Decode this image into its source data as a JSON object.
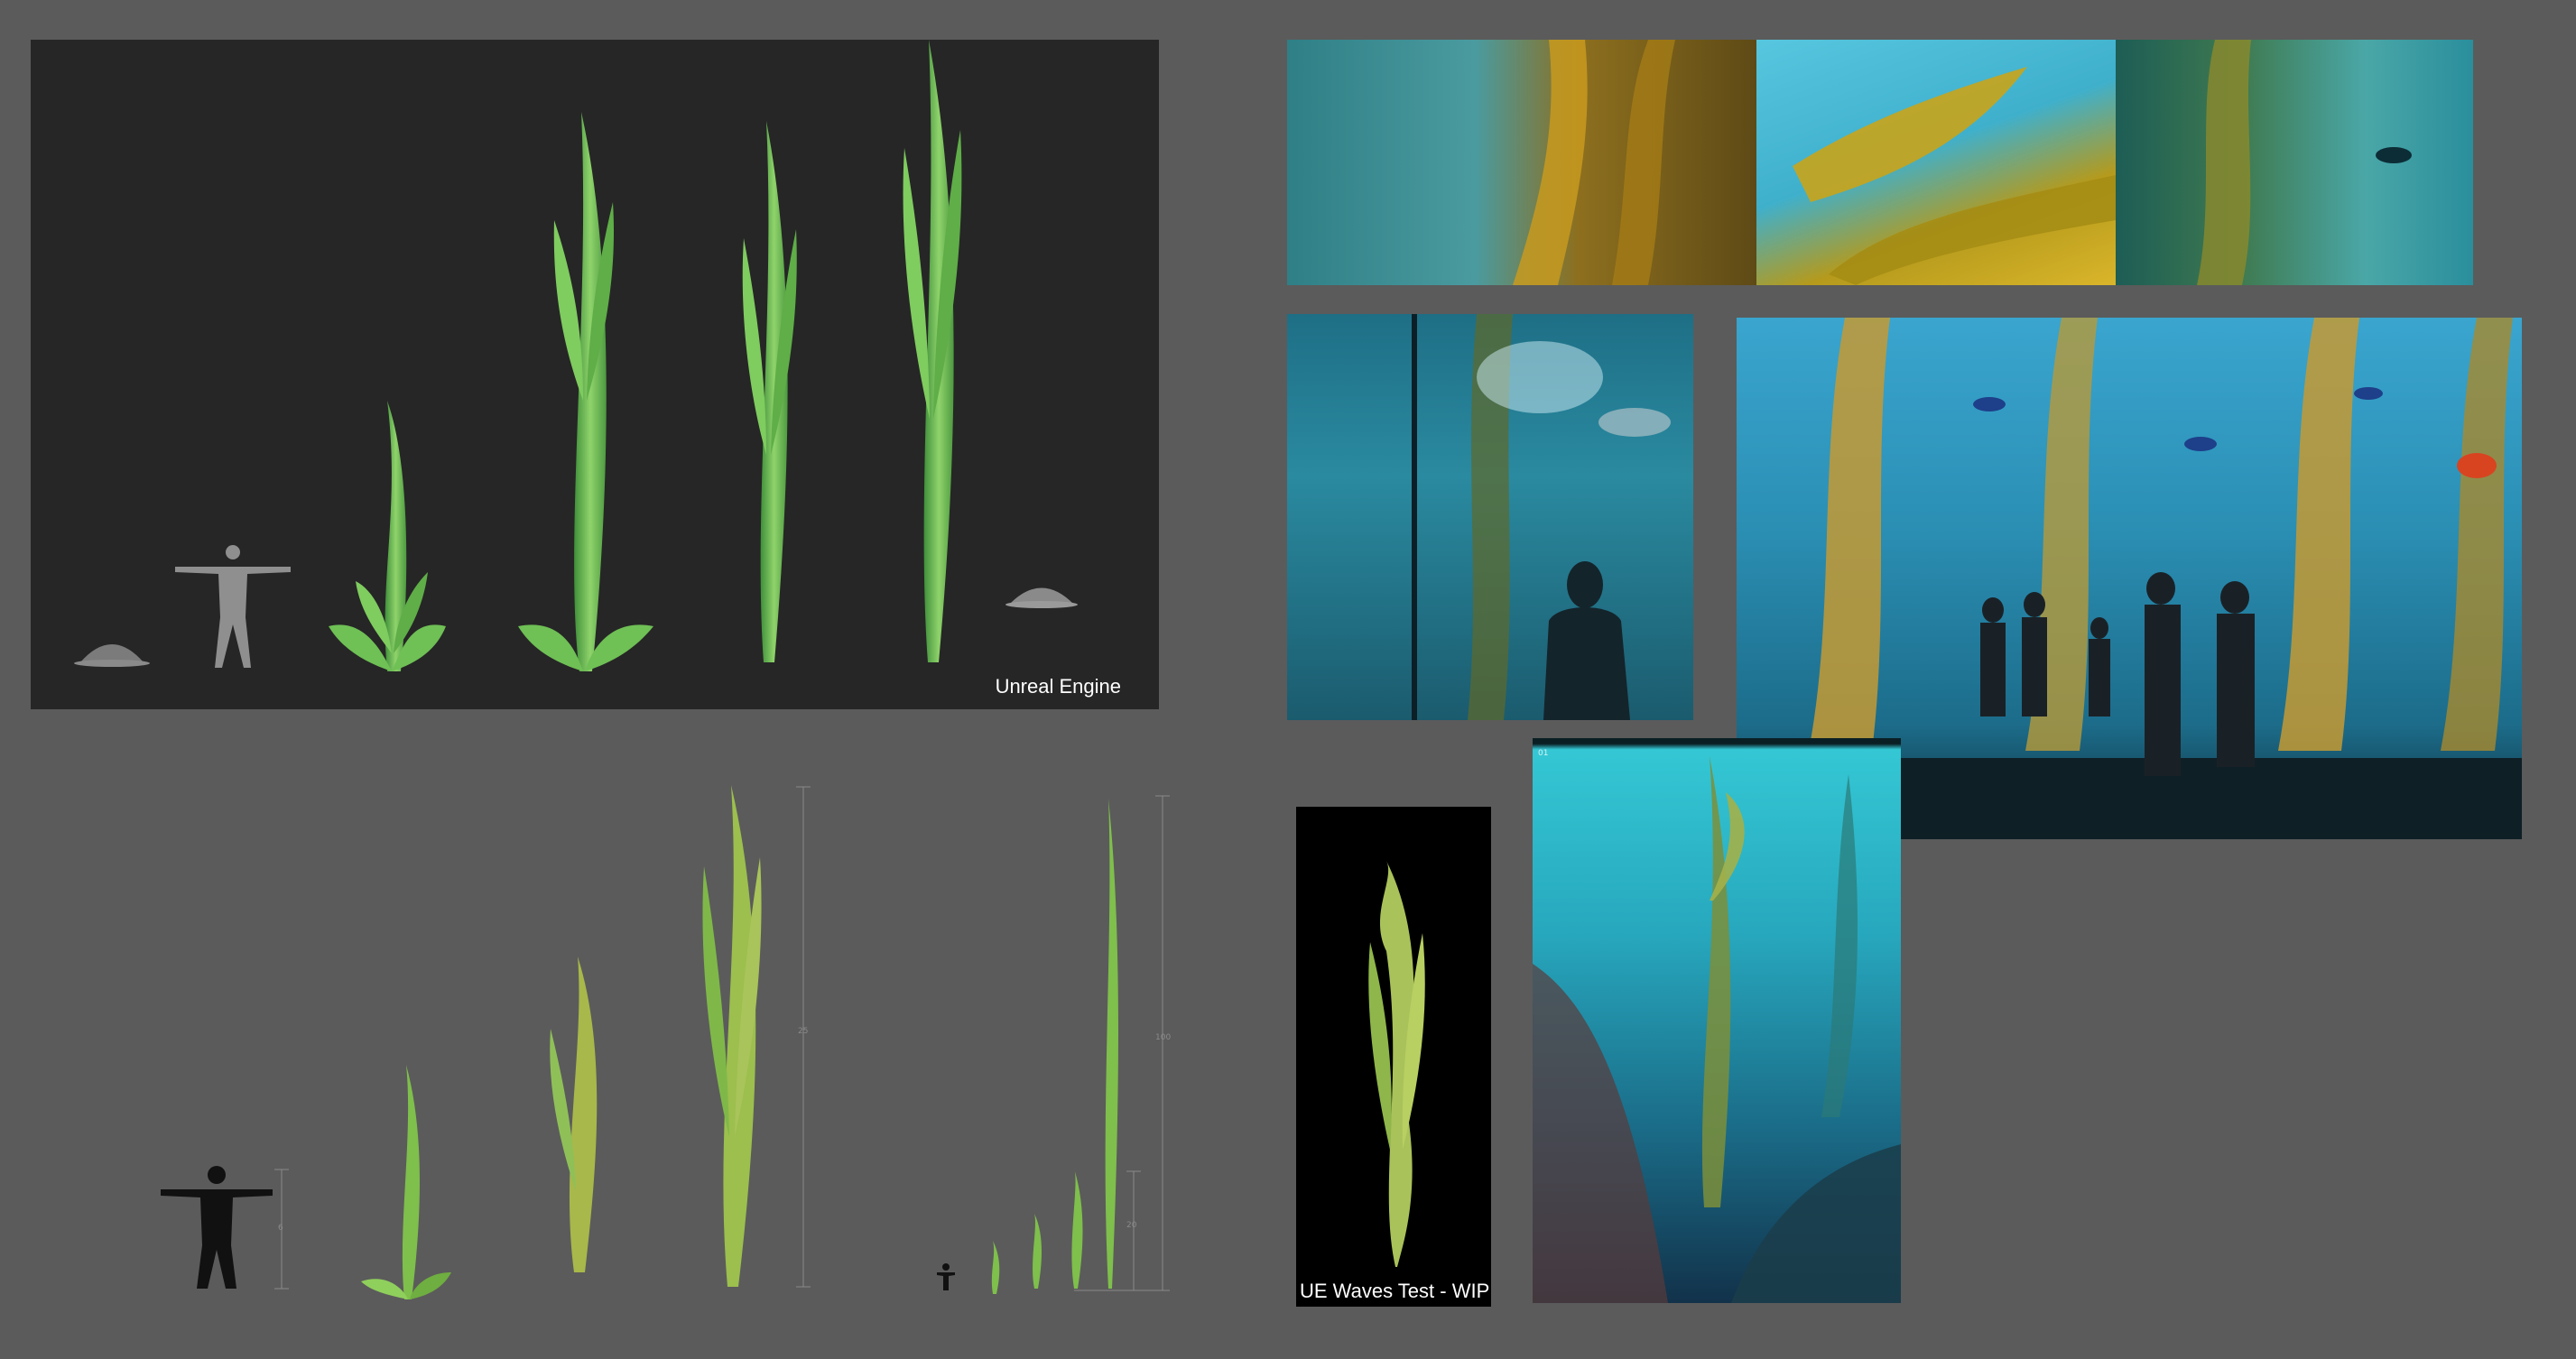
{
  "ue_panel": {
    "label": "Unreal Engine"
  },
  "waves_panel": {
    "label": "UE Waves Test - WIP"
  },
  "dimensions": {
    "small_figure": "6",
    "tall_kelp": "25",
    "giant_kelp_total": "100",
    "giant_kelp_lower": "20"
  },
  "concept_panel": {
    "frame_number": "01"
  }
}
